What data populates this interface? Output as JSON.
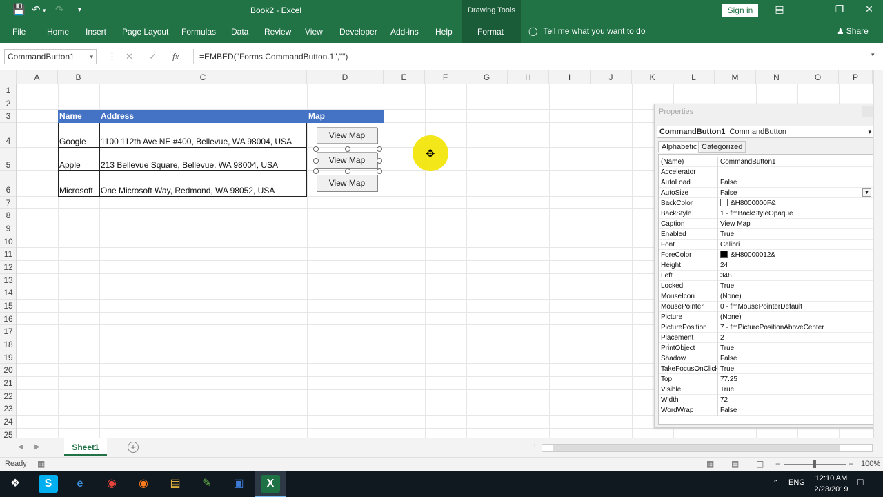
{
  "window": {
    "title": "Book2  -  Excel",
    "context_tab_group": "Drawing Tools",
    "signin_label": "Sign in"
  },
  "ribbon": {
    "tabs": [
      {
        "label": "File"
      },
      {
        "label": "Home"
      },
      {
        "label": "Insert"
      },
      {
        "label": "Page Layout"
      },
      {
        "label": "Formulas"
      },
      {
        "label": "Data"
      },
      {
        "label": "Review"
      },
      {
        "label": "View"
      },
      {
        "label": "Developer"
      },
      {
        "label": "Add-ins"
      },
      {
        "label": "Help"
      },
      {
        "label": "Format"
      }
    ],
    "tell_me": "Tell me what you want to do",
    "share": "Share"
  },
  "formula_bar": {
    "name_box": "CommandButton1",
    "formula": "=EMBED(\"Forms.CommandButton.1\",\"\")"
  },
  "grid": {
    "columns": [
      "A",
      "B",
      "C",
      "D",
      "E",
      "F",
      "G",
      "H",
      "I",
      "J",
      "K",
      "L",
      "M",
      "N",
      "O",
      "P"
    ],
    "rows": [
      "1",
      "2",
      "3",
      "4",
      "5",
      "6",
      "7",
      "8",
      "9",
      "10",
      "11",
      "12",
      "13",
      "14",
      "15",
      "16",
      "17",
      "18",
      "19",
      "20",
      "21",
      "22",
      "23",
      "24",
      "25"
    ]
  },
  "table": {
    "headers": [
      "Name",
      "Address",
      "Map"
    ],
    "rows": [
      {
        "name": "Google",
        "address": "1100 112th Ave NE #400, Bellevue, WA 98004, USA"
      },
      {
        "name": "Apple",
        "address": "213 Bellevue Square, Bellevue, WA 98004, USA"
      },
      {
        "name": "Microsoft",
        "address": "One Microsoft Way, Redmond, WA 98052, USA"
      }
    ],
    "buttons": [
      "View Map",
      "View Map",
      "View Map"
    ]
  },
  "properties": {
    "title": "Properties",
    "object_name": "CommandButton1",
    "object_type": "CommandButton",
    "tabs": [
      "Alphabetic",
      "Categorized"
    ],
    "rows": [
      {
        "name": "(Name)",
        "value": "CommandButton1"
      },
      {
        "name": "Accelerator",
        "value": ""
      },
      {
        "name": "AutoLoad",
        "value": "False"
      },
      {
        "name": "AutoSize",
        "value": "False"
      },
      {
        "name": "BackColor",
        "value": "&H8000000F&",
        "swatch": "#ffffff"
      },
      {
        "name": "BackStyle",
        "value": "1 - fmBackStyleOpaque"
      },
      {
        "name": "Caption",
        "value": "View Map"
      },
      {
        "name": "Enabled",
        "value": "True"
      },
      {
        "name": "Font",
        "value": "Calibri"
      },
      {
        "name": "ForeColor",
        "value": "&H80000012&",
        "swatch": "#000000"
      },
      {
        "name": "Height",
        "value": "24"
      },
      {
        "name": "Left",
        "value": "348"
      },
      {
        "name": "Locked",
        "value": "True"
      },
      {
        "name": "MouseIcon",
        "value": "(None)"
      },
      {
        "name": "MousePointer",
        "value": "0 - fmMousePointerDefault"
      },
      {
        "name": "Picture",
        "value": "(None)"
      },
      {
        "name": "PicturePosition",
        "value": "7 - fmPicturePositionAboveCenter"
      },
      {
        "name": "Placement",
        "value": "2"
      },
      {
        "name": "PrintObject",
        "value": "True"
      },
      {
        "name": "Shadow",
        "value": "False"
      },
      {
        "name": "TakeFocusOnClick",
        "value": "True"
      },
      {
        "name": "Top",
        "value": "77.25"
      },
      {
        "name": "Visible",
        "value": "True"
      },
      {
        "name": "Width",
        "value": "72"
      },
      {
        "name": "WordWrap",
        "value": "False"
      }
    ]
  },
  "sheets": [
    {
      "label": "Sheet1"
    }
  ],
  "status": {
    "ready": "Ready",
    "zoom": "100%"
  },
  "taskbar": {
    "language": "ENG",
    "time": "12:10 AM",
    "date": "2/23/2019"
  },
  "colors": {
    "excel_green": "#217346",
    "table_header": "#4472c4",
    "cursor_highlight": "#f2e300"
  }
}
